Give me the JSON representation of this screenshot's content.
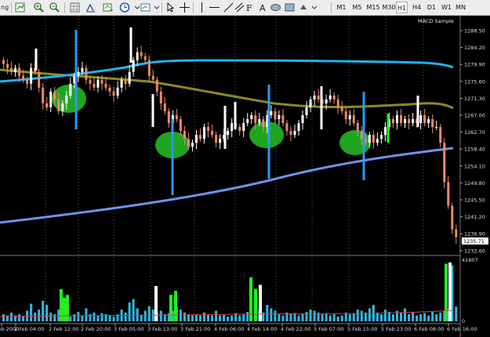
{
  "toolbar": {
    "left_text": "ng",
    "timeframes": [
      {
        "label": "M1",
        "active": false
      },
      {
        "label": "M5",
        "active": false
      },
      {
        "label": "M15",
        "active": false
      },
      {
        "label": "M30",
        "active": false
      },
      {
        "label": "H1",
        "active": true
      },
      {
        "label": "H4",
        "active": false
      },
      {
        "label": "D1",
        "active": false
      },
      {
        "label": "W1",
        "active": false
      },
      {
        "label": "MN",
        "active": false
      }
    ],
    "icons": [
      "zoom-in-icon",
      "zoom-out-icon",
      "grid-icon",
      "period-separator-icon",
      "bar-chart-icon",
      "candle-chart-icon",
      "line-chart-icon",
      "indicators-icon",
      "clock-icon",
      "templates-icon",
      "cursor-icon",
      "crosshair-icon",
      "vertical-line-icon",
      "horizontal-line-icon",
      "trendline-icon",
      "channel-icon",
      "fibonacci-icon",
      "text-icon",
      "label-icon",
      "ellipse-icon",
      "rectangle-icon",
      "arrows-icon"
    ]
  },
  "indicator_label": "MACD Sample",
  "current_price": "1235.71",
  "price_axis": [
    "1288.50",
    "1284.20",
    "1279.90",
    "1275.60",
    "1271.30",
    "1267.00",
    "1262.70",
    "1258.40",
    "1254.10",
    "1249.80",
    "1245.50",
    "1241.20",
    "1236.90",
    "1232.60"
  ],
  "volume_axis": {
    "top": "41807",
    "bottom": "0"
  },
  "time_axis": [
    "1 Feb 2000",
    "2 Feb 04:00",
    "2 Feb 12:00",
    "2 Feb 20:00",
    "3 Feb 05:00",
    "3 Feb 13:00",
    "3 Feb 21:00",
    "4 Feb 06:00",
    "4 Feb 14:00",
    "4 Feb 22:00",
    "5 Feb 07:00",
    "5 Feb 15:00",
    "5 Feb 23:00",
    "6 Feb 08:00",
    "6 Feb 16:00"
  ],
  "colors": {
    "background": "#000000",
    "bull_candle": "#ffffff",
    "bear_candle": "#e98a66",
    "ma_fast": "#1eb4f0",
    "ma_slow": "#8c8a20",
    "channel_line": "#6f93ea",
    "marker_lines": "#2f97ee",
    "highlight_circles": "#1fa51f",
    "volume": "#2db9e8",
    "volume_highlight_green": "#22ee22",
    "volume_highlight_white": "#ffffff",
    "grid": "#5a5a5a"
  }
}
